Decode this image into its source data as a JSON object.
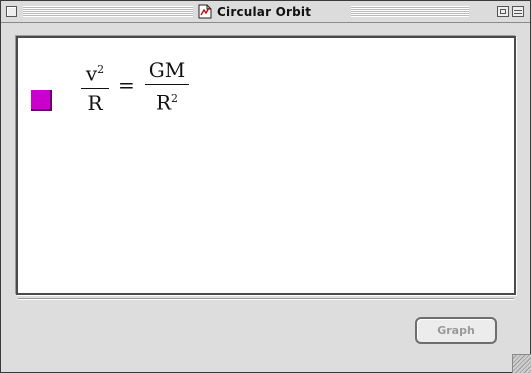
{
  "window": {
    "title": "Circular Orbit",
    "accent_swatch_color": "#cc00cc"
  },
  "equation": {
    "left_numerator": "v",
    "left_numerator_exp": "2",
    "left_denominator": "R",
    "equals": "=",
    "right_numerator": "GM",
    "right_denominator": "R",
    "right_denominator_exp": "2"
  },
  "buttons": {
    "graph_label": "Graph"
  }
}
